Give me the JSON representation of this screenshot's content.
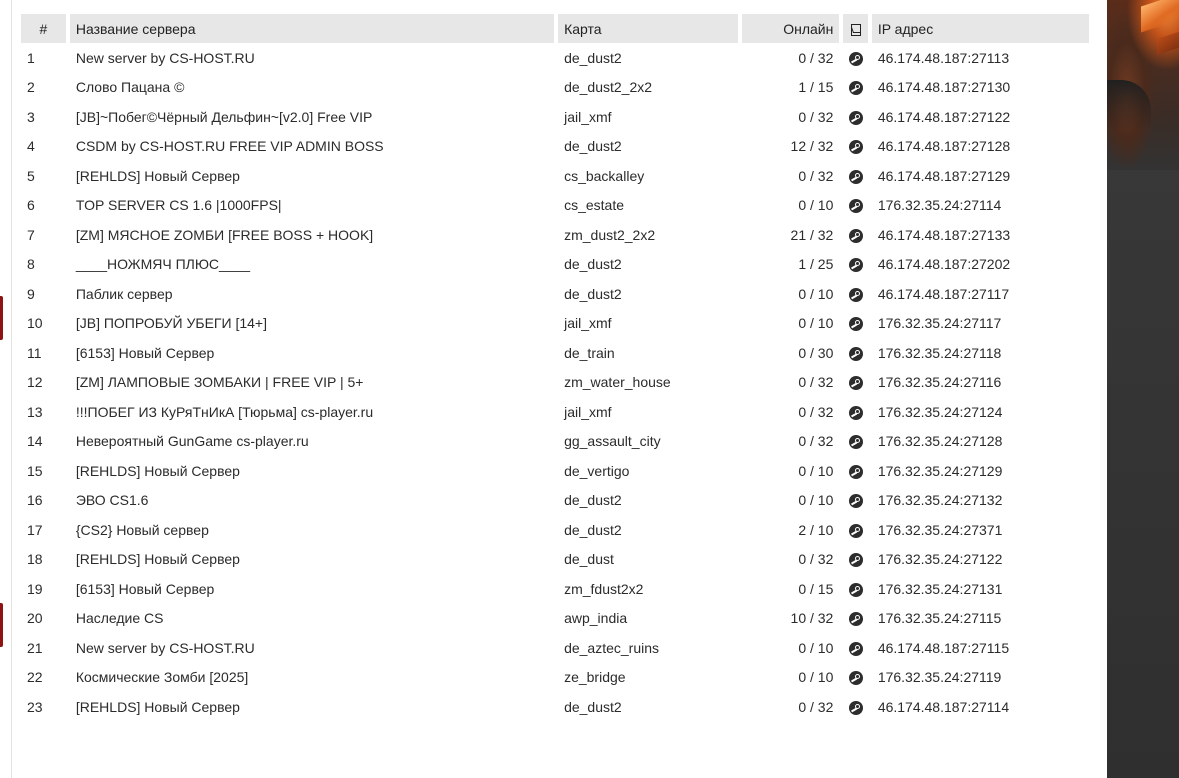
{
  "table": {
    "headers": {
      "num": "#",
      "name": "Название сервера",
      "map": "Карта",
      "online": "Онлайн",
      "steam_icon": "steam-column-icon",
      "ip": "IP адрес"
    },
    "rows": [
      {
        "num": "1",
        "name": "New server by CS-HOST.RU",
        "map": "de_dust2",
        "online": "0 / 32",
        "ip": "46.174.48.187:27113"
      },
      {
        "num": "2",
        "name": "Слово Пацана ©",
        "map": "de_dust2_2x2",
        "online": "1 / 15",
        "ip": "46.174.48.187:27130"
      },
      {
        "num": "3",
        "name": "[JB]~Побег©Чёрный Дельфин~[v2.0] Free VIP",
        "map": "jail_xmf",
        "online": "0 / 32",
        "ip": "46.174.48.187:27122"
      },
      {
        "num": "4",
        "name": "CSDM by CS-HOST.RU FREE VIP ADMIN BOSS",
        "map": "de_dust2",
        "online": "12 / 32",
        "ip": "46.174.48.187:27128"
      },
      {
        "num": "5",
        "name": "[REHLDS] Новый Сервер",
        "map": "cs_backalley",
        "online": "0 / 32",
        "ip": "46.174.48.187:27129"
      },
      {
        "num": "6",
        "name": "TOP SERVER CS 1.6 |1000FPS|",
        "map": "cs_estate",
        "online": "0 / 10",
        "ip": "176.32.35.24:27114"
      },
      {
        "num": "7",
        "name": "[ZM] МЯСНОЕ ZOМБИ [FREE BOSS + HOOK]",
        "map": "zm_dust2_2x2",
        "online": "21 / 32",
        "ip": "46.174.48.187:27133"
      },
      {
        "num": "8",
        "name": "____НОЖМЯЧ ПЛЮС____",
        "map": "de_dust2",
        "online": "1 / 25",
        "ip": "46.174.48.187:27202"
      },
      {
        "num": "9",
        "name": "Паблик сервер",
        "map": "de_dust2",
        "online": "0 / 10",
        "ip": "46.174.48.187:27117"
      },
      {
        "num": "10",
        "name": "[JB] ПОПРОБУЙ УБЕГИ [14+]",
        "map": "jail_xmf",
        "online": "0 / 10",
        "ip": "176.32.35.24:27117"
      },
      {
        "num": "11",
        "name": "[6153] Новый Сервер",
        "map": "de_train",
        "online": "0 / 30",
        "ip": "176.32.35.24:27118"
      },
      {
        "num": "12",
        "name": "[ZM] ЛАМПОВЫЕ ЗОМБАКИ | FREE VIP | 5+",
        "map": "zm_water_house",
        "online": "0 / 32",
        "ip": "176.32.35.24:27116"
      },
      {
        "num": "13",
        "name": "!!!ПОБЕГ ИЗ КуРяТнИкА [Тюрьма] cs-player.ru",
        "map": "jail_xmf",
        "online": "0 / 32",
        "ip": "176.32.35.24:27124"
      },
      {
        "num": "14",
        "name": "Невероятный GunGame cs-player.ru",
        "map": "gg_assault_city",
        "online": "0 / 32",
        "ip": "176.32.35.24:27128"
      },
      {
        "num": "15",
        "name": "[REHLDS] Новый Сервер",
        "map": "de_vertigo",
        "online": "0 / 10",
        "ip": "176.32.35.24:27129"
      },
      {
        "num": "16",
        "name": "ЭВО CS1.6",
        "map": "de_dust2",
        "online": "0 / 10",
        "ip": "176.32.35.24:27132"
      },
      {
        "num": "17",
        "name": "{CS2} Новый сервер",
        "map": "de_dust2",
        "online": "2 / 10",
        "ip": "176.32.35.24:27371"
      },
      {
        "num": "18",
        "name": "[REHLDS] Новый Сервер",
        "map": "de_dust",
        "online": "0 / 32",
        "ip": "176.32.35.24:27122"
      },
      {
        "num": "19",
        "name": "[6153] Новый Сервер",
        "map": "zm_fdust2x2",
        "online": "0 / 15",
        "ip": "176.32.35.24:27131"
      },
      {
        "num": "20",
        "name": "Наследие CS",
        "map": "awp_india",
        "online": "10 / 32",
        "ip": "176.32.35.24:27115"
      },
      {
        "num": "21",
        "name": "New server by CS-HOST.RU",
        "map": "de_aztec_ruins",
        "online": "0 / 10",
        "ip": "46.174.48.187:27115"
      },
      {
        "num": "22",
        "name": "Космические Зомби [2025]",
        "map": "ze_bridge",
        "online": "0 / 10",
        "ip": "176.32.35.24:27119"
      },
      {
        "num": "23",
        "name": "[REHLDS] Новый Сервер",
        "map": "de_dust2",
        "online": "0 / 32",
        "ip": "46.174.48.187:27114"
      }
    ],
    "row_icon": "steam-icon"
  },
  "colors": {
    "header_bg": "#e7e7e7",
    "accent_tab": "#8e1414",
    "right_panel": "#333333"
  }
}
